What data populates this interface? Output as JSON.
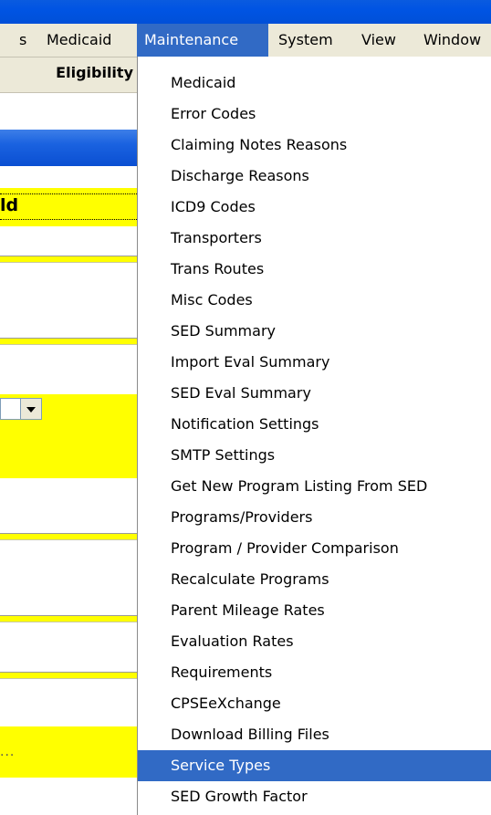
{
  "menubar": {
    "items": [
      {
        "label": "s"
      },
      {
        "label": "Medicaid"
      },
      {
        "label": "Maintenance"
      },
      {
        "label": "System"
      },
      {
        "label": "View"
      },
      {
        "label": "Window"
      }
    ]
  },
  "toolbar": {
    "eligibility_label": "Eligibility"
  },
  "left_pane": {
    "field_fragment": "ld",
    "link_fragment": "..."
  },
  "maintenance_menu": {
    "items": [
      {
        "label": "Medicaid"
      },
      {
        "label": "Error Codes"
      },
      {
        "label": "Claiming Notes Reasons"
      },
      {
        "label": "Discharge Reasons"
      },
      {
        "label": "ICD9 Codes"
      },
      {
        "label": "Transporters"
      },
      {
        "label": "Trans Routes"
      },
      {
        "label": "Misc Codes"
      },
      {
        "label": "SED Summary"
      },
      {
        "label": "Import Eval Summary"
      },
      {
        "label": "SED Eval Summary"
      },
      {
        "label": "Notification Settings"
      },
      {
        "label": "SMTP Settings"
      },
      {
        "label": "Get New Program Listing From SED"
      },
      {
        "label": "Programs/Providers"
      },
      {
        "label": "Program / Provider Comparison"
      },
      {
        "label": "Recalculate Programs"
      },
      {
        "label": "Parent Mileage Rates"
      },
      {
        "label": "Evaluation Rates"
      },
      {
        "label": "Requirements"
      },
      {
        "label": "CPSEeXchange"
      },
      {
        "label": "Download Billing Files"
      },
      {
        "label": "Service Types"
      },
      {
        "label": "SED Growth Factor"
      }
    ],
    "selected_item": "Service Types"
  },
  "colors": {
    "title_bar": "#0054e3",
    "menu_highlight": "#316ac5",
    "menubar_bg": "#ece9d8",
    "field_yellow": "#ffff00"
  }
}
